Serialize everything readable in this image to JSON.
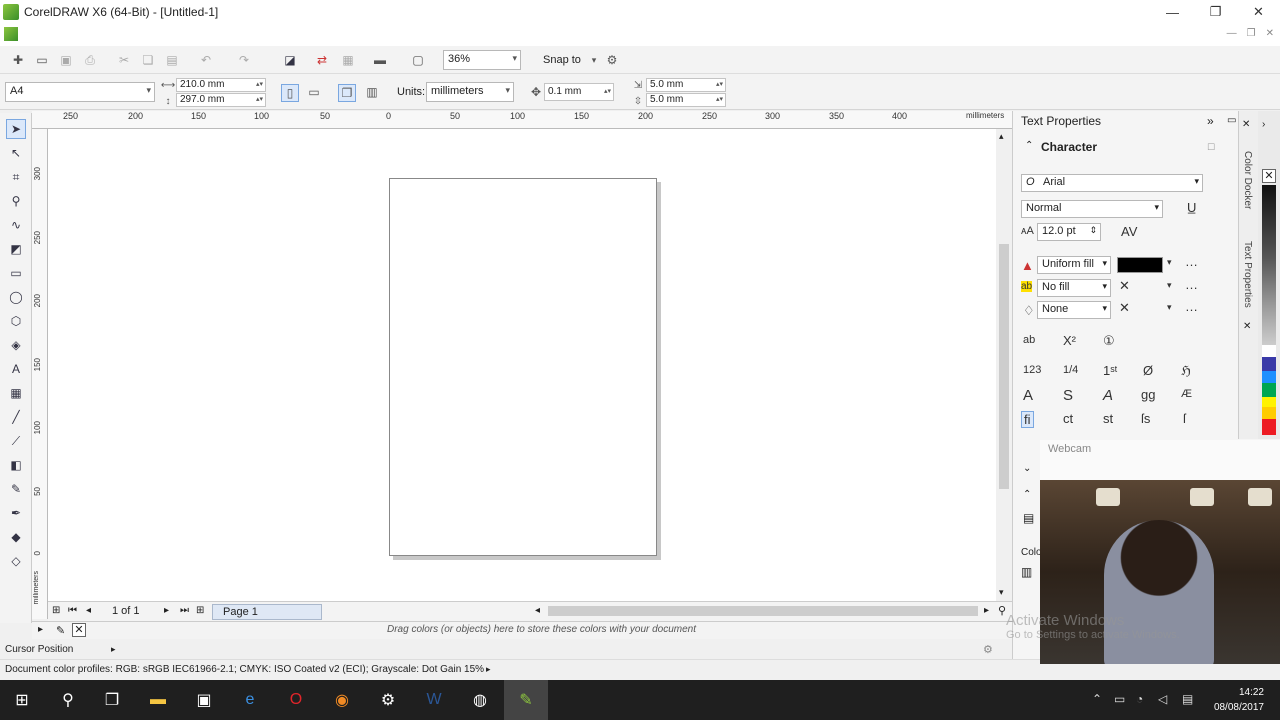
{
  "window": {
    "title": "CorelDRAW X6 (64-Bit) - [Untitled-1]",
    "minimize": "—",
    "restore": "❐",
    "close": "✕"
  },
  "toolbar": {
    "zoom_value": "36%",
    "snap_to": "Snap to"
  },
  "propbar": {
    "paper_preset": "A4",
    "width": "210.0 mm",
    "height": "297.0 mm",
    "units_label": "Units:",
    "units_value": "millimeters",
    "nudge": "0.1 mm",
    "dup_x": "5.0 mm",
    "dup_y": "5.0 mm"
  },
  "ruler": {
    "unit_label": "millimeters",
    "h_ticks": [
      "250",
      "200",
      "150",
      "100",
      "50",
      "0",
      "50",
      "100",
      "150",
      "200",
      "250",
      "300",
      "350",
      "400"
    ],
    "v_ticks": [
      "300",
      "250",
      "200",
      "150",
      "100",
      "50",
      "0"
    ],
    "v_unit": "millimeters"
  },
  "pagenav": {
    "count": "1 of 1",
    "page_tab": "Page 1"
  },
  "colorstrip": {
    "hint": "Drag colors (or objects) here to store these colors with your document"
  },
  "status": {
    "cursor_position": "Cursor Position",
    "color_profiles": "Document color profiles: RGB: sRGB IEC61966-2.1; CMYK: ISO Coated v2 (ECI); Grayscale: Dot Gain 15%"
  },
  "docker": {
    "title": "Text Properties",
    "section": "Character",
    "font": "Arial",
    "style": "Normal",
    "size": "12.0 pt",
    "fill_type": "Uniform fill",
    "bg_fill": "No fill",
    "outline": "None",
    "fill_color": "#000000"
  },
  "sidetabs": {
    "color_docker": "Color Docker",
    "text_properties": "Text Properties"
  },
  "docker2": {
    "partial_label": "Colo"
  },
  "webcam": {
    "label": "Webcam"
  },
  "watermark": {
    "line1": "Activate Windows",
    "line2": "Go to Settings to activate Windows."
  },
  "palette": {
    "colors": [
      "#ffffff",
      "#3a3aa8",
      "#1e90ff",
      "#00a651",
      "#fff200",
      "#ffcc00",
      "#ed1c24"
    ]
  },
  "taskbar": {
    "time": "14:22",
    "date": "08/08/2017"
  }
}
